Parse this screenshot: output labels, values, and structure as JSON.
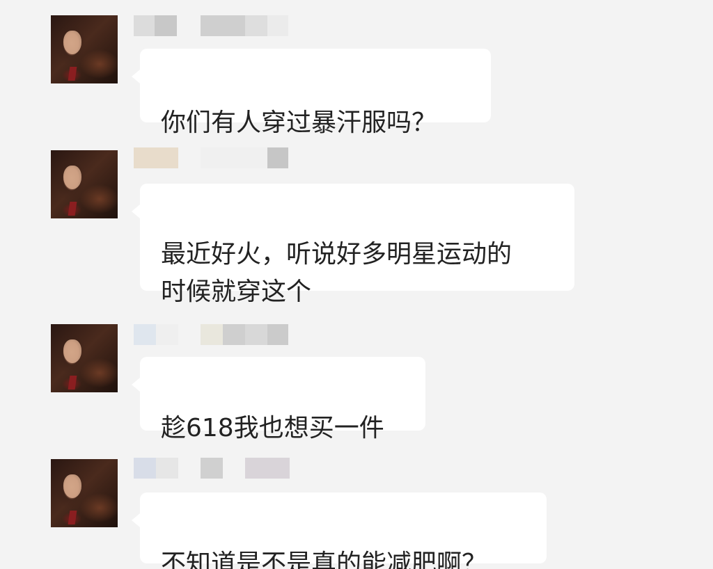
{
  "chat": {
    "messages": [
      {
        "text": "你们有人穿过暴汗服吗？"
      },
      {
        "text": "最近好火，听说好多明星运动的\n时候就穿这个"
      },
      {
        "text": "趁618我也想买一件"
      },
      {
        "text": "不知道是不是真的能减肥啊？"
      }
    ]
  },
  "colors": {
    "background": "#f3f3f3",
    "bubble": "#ffffff",
    "text": "#222222"
  },
  "icons": [
    "avatar"
  ]
}
